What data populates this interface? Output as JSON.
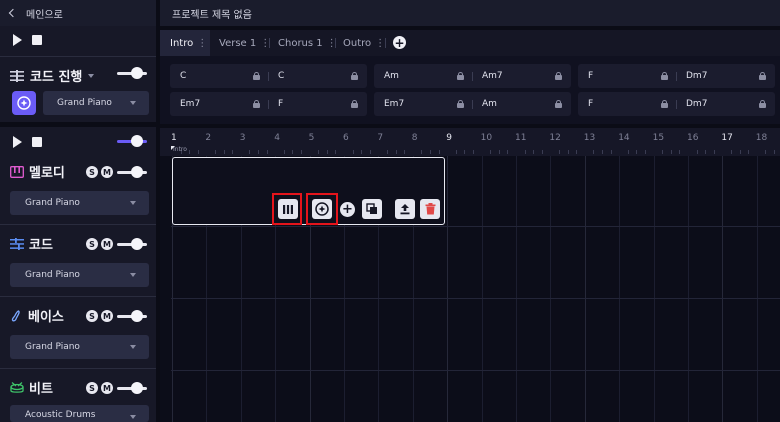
{
  "nav": {
    "back_label": "메인으로",
    "project_title": "프로젝트 제목 없음"
  },
  "chord_track": {
    "title": "코드 진행",
    "instrument": "Grand Piano"
  },
  "tracks": [
    {
      "name": "멜로디",
      "instrument": "Grand Piano",
      "icon": "piano-icon",
      "color": "#e05bd0"
    },
    {
      "name": "코드",
      "instrument": "Grand Piano",
      "icon": "chord-lines-icon",
      "color": "#5a8cf0"
    },
    {
      "name": "베이스",
      "instrument": "Grand Piano",
      "icon": "bass-icon",
      "color": "#7aa7ff"
    },
    {
      "name": "비트",
      "instrument": "Acoustic Drums",
      "icon": "drum-icon",
      "color": "#3fc46a"
    }
  ],
  "badges": {
    "solo": "S",
    "mute": "M"
  },
  "sections": [
    {
      "label": "Intro",
      "active": true
    },
    {
      "label": "Verse 1",
      "active": false
    },
    {
      "label": "Chorus 1",
      "active": false
    },
    {
      "label": "Outro",
      "active": false
    }
  ],
  "chord_rows": [
    [
      "C",
      "C",
      "Am",
      "Am7",
      "F",
      "Dm7"
    ],
    [
      "Em7",
      "F",
      "Em7",
      "Am",
      "F",
      "Dm7"
    ]
  ],
  "ruler": {
    "bars": [
      "1",
      "2",
      "3",
      "4",
      "5",
      "6",
      "7",
      "8",
      "9",
      "10",
      "11",
      "12",
      "13",
      "14",
      "15",
      "16",
      "17",
      "18"
    ],
    "marker_label": "Intro"
  },
  "colors": {
    "accent": "#6b5cf6",
    "highlight": "#e4141b",
    "delete": "#e04848"
  }
}
